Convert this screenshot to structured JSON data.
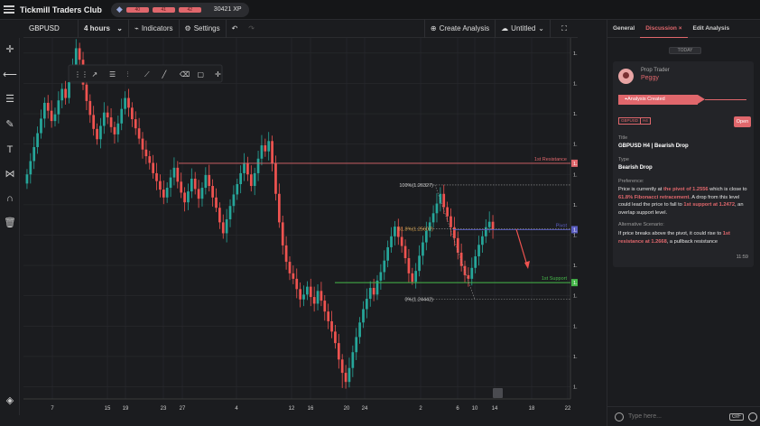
{
  "app": {
    "title": "Tickmill Traders Club",
    "levels": [
      "40",
      "41",
      "42"
    ],
    "xp": "30421 XP"
  },
  "toolbar": {
    "symbol": "GBPUSD",
    "timeframe": "4 hours",
    "indicators": "Indicators",
    "settings": "Settings",
    "create_analysis": "Create Analysis",
    "untitled": "Untitled"
  },
  "chart_data": {
    "type": "candlestick",
    "instrument": "GBPUSD",
    "interval": "4 hours",
    "ylim": [
      1.228,
      1.2875
    ],
    "y_ticks": [
      "1.28500",
      "1.28000",
      "1.27500",
      "1.27000",
      "1.26500",
      "1.26000",
      "1.25500",
      "1.25000",
      "1.24500",
      "1.24000",
      "1.23500",
      "1.23000"
    ],
    "x_ticks": [
      "7",
      "15",
      "19",
      "23",
      "27",
      "4",
      "12",
      "16",
      "20",
      "24",
      "2",
      "6",
      "10",
      "14",
      "18",
      "22"
    ],
    "closes": [
      1.265,
      1.2672,
      1.2695,
      1.2718,
      1.2742,
      1.2768,
      1.2755,
      1.2738,
      1.2749,
      1.2772,
      1.2791,
      1.2776,
      1.2802,
      1.283,
      1.2858,
      1.2839,
      1.2798,
      1.2771,
      1.2748,
      1.2725,
      1.2708,
      1.273,
      1.2752,
      1.2744,
      1.2728,
      1.2716,
      1.2734,
      1.2758,
      1.2776,
      1.276,
      1.2741,
      1.2726,
      1.2709,
      1.2691,
      1.268,
      1.2669,
      1.2652,
      1.2639,
      1.2625,
      1.2612,
      1.2628,
      1.2645,
      1.2661,
      1.2638,
      1.262,
      1.2604,
      1.2622,
      1.2643,
      1.2626,
      1.261,
      1.2628,
      1.2649,
      1.2631,
      1.2612,
      1.2595,
      1.2571,
      1.2553,
      1.2576,
      1.2598,
      1.2617,
      1.2634,
      1.2652,
      1.2668,
      1.265,
      1.2631,
      1.2652,
      1.2676,
      1.2698,
      1.2688,
      1.2705,
      1.2668,
      1.2618,
      1.2571,
      1.2533,
      1.2506,
      1.2487,
      1.2478,
      1.2461,
      1.2444,
      1.2452,
      1.2465,
      1.2448,
      1.2437,
      1.2458,
      1.2442,
      1.2424,
      1.2408,
      1.2391,
      1.2372,
      1.2345,
      1.2323,
      1.2308,
      1.2331,
      1.2357,
      1.2382,
      1.2406,
      1.2428,
      1.2445,
      1.2463,
      1.2452,
      1.2475,
      1.2489,
      1.2508,
      1.253,
      1.2548,
      1.2564,
      1.2547,
      1.2532,
      1.2512,
      1.2487,
      1.2473,
      1.2491,
      1.2516,
      1.2538,
      1.2557,
      1.2571,
      1.2586,
      1.2602,
      1.2618,
      1.2596,
      1.2581,
      1.2563,
      1.2545,
      1.2521,
      1.2499,
      1.2484,
      1.2478,
      1.2496,
      1.2515,
      1.2534,
      1.2548,
      1.2563,
      1.2572,
      1.2559
    ],
    "lows": [
      {
        "i": 13,
        "v": 1.2815
      },
      {
        "i": 54,
        "v": 1.2588
      },
      {
        "i": 90,
        "v": 1.2298
      },
      {
        "i": 110,
        "v": 1.2468
      },
      {
        "i": 125,
        "v": 1.2472
      }
    ],
    "levels": [
      {
        "label": "1st Resistance",
        "price_tag": "1.26684",
        "value": 1.26684,
        "color": "#e0676c"
      },
      {
        "label": "Pivot",
        "price_tag": "1.25590",
        "value": 1.2559,
        "color": "#5b5ec2"
      },
      {
        "label": "1st Support",
        "price_tag": "1.24717",
        "value": 1.24717,
        "color": "#46b84a"
      }
    ],
    "fibonacci": [
      {
        "label": "100%(1.26327)",
        "value": 1.26327
      },
      {
        "label": "61.8%(1.25607)",
        "value": 1.25607
      },
      {
        "label": "0%(1.24442)",
        "value": 1.24442
      }
    ],
    "colors": {
      "up": "#26a69a",
      "down": "#ef5350",
      "background": "#1b1c1f",
      "grid": "#2a2b2f"
    }
  },
  "panel": {
    "tabs": [
      "General",
      "Discussion ×",
      "Edit Analysis"
    ],
    "today": "TODAY",
    "role": "Prop Trader",
    "user": "Peggy",
    "status": "Analysis Created",
    "tags": [
      "GBPUSD",
      "H4"
    ],
    "open": "Open",
    "title_label": "Title",
    "title_value": "GBPUSD H4 | Bearish Drop",
    "type_label": "Type",
    "type_value": "Bearish Drop",
    "pref_label": "Preference:",
    "alt_label": "Alternative Scenario:",
    "time": "11:59",
    "placeholder": "Type here...",
    "gif": "GIF"
  }
}
